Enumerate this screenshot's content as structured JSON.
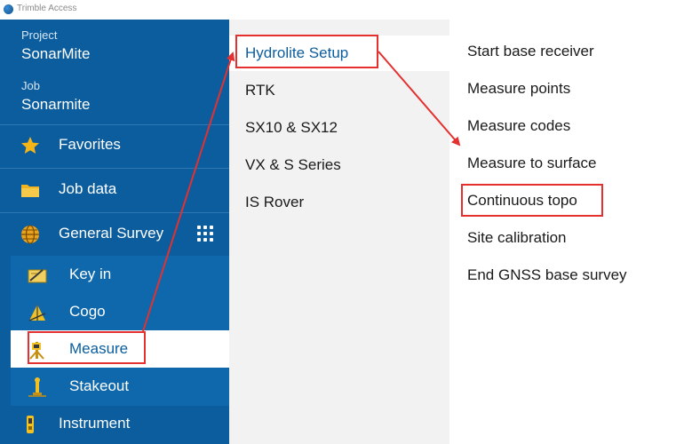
{
  "app": {
    "title": "Trimble Access"
  },
  "sidebar": {
    "project_label": "Project",
    "project_name": "SonarMite",
    "job_label": "Job",
    "job_name": "Sonarmite",
    "items": [
      {
        "label": "Favorites",
        "icon": "star-icon"
      },
      {
        "label": "Job data",
        "icon": "folder-icon"
      },
      {
        "label": "General Survey",
        "icon": "globe-icon",
        "extra_icon": "grid-menu-icon"
      },
      {
        "label": "Key in",
        "icon": "key-in-icon"
      },
      {
        "label": "Cogo",
        "icon": "cogo-icon"
      },
      {
        "label": "Measure",
        "icon": "measure-icon",
        "active": true
      },
      {
        "label": "Stakeout",
        "icon": "stakeout-icon"
      },
      {
        "label": "Instrument",
        "icon": "instrument-icon"
      }
    ]
  },
  "styles_menu": {
    "items": [
      {
        "label": "Hydrolite Setup",
        "selected": true
      },
      {
        "label": "RTK"
      },
      {
        "label": "SX10 & SX12"
      },
      {
        "label": "VX & S Series"
      },
      {
        "label": "IS Rover"
      }
    ]
  },
  "measure_menu": {
    "items": [
      {
        "label": "Start base receiver"
      },
      {
        "label": "Measure points"
      },
      {
        "label": "Measure codes"
      },
      {
        "label": "Measure to surface"
      },
      {
        "label": "Continuous topo",
        "highlighted": true
      },
      {
        "label": "Site calibration"
      },
      {
        "label": "End GNSS base survey"
      }
    ]
  },
  "colors": {
    "sidebar_bg": "#0b5d9e",
    "submenu_bg": "#0e68ab",
    "accent": "#0b5d9e",
    "annotation": "#e53030"
  }
}
